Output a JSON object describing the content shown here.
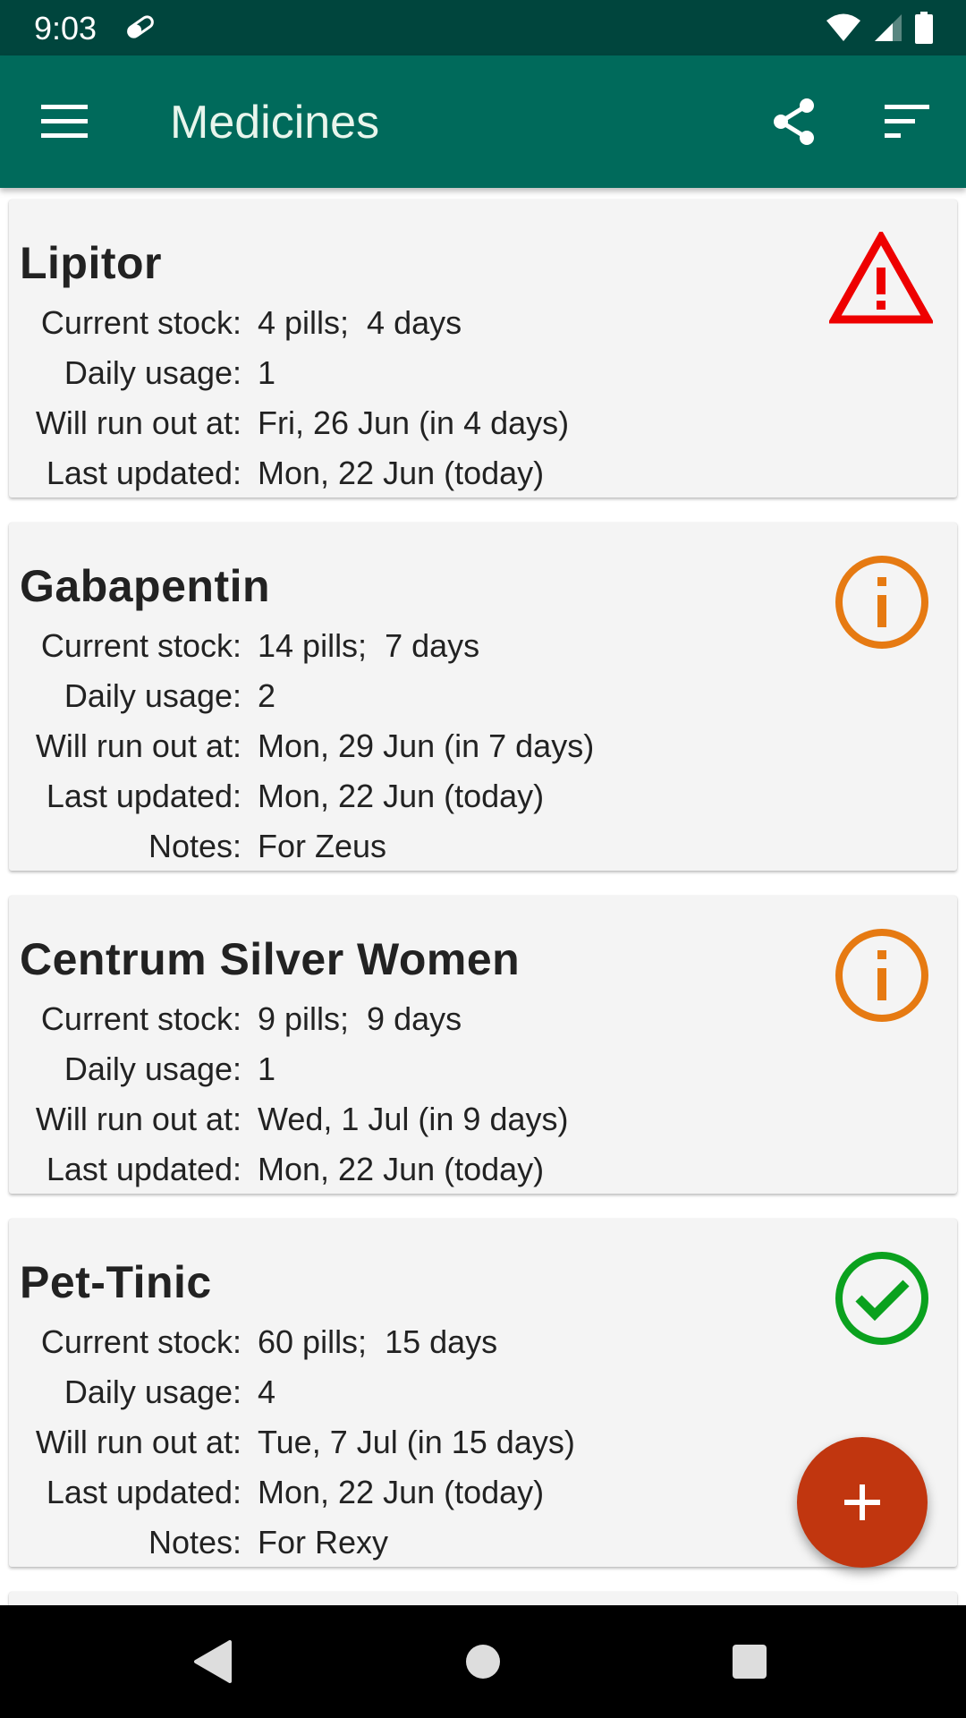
{
  "status_bar": {
    "time": "9:03",
    "icons": [
      "pill-notification-icon",
      "wifi-icon",
      "signal-icon",
      "battery-icon"
    ]
  },
  "app_bar": {
    "title": "Medicines",
    "icons": {
      "menu": "menu-icon",
      "share": "share-icon",
      "sort": "sort-icon"
    },
    "background_color": "#006a5b"
  },
  "labels": {
    "current_stock": "Current stock:",
    "daily_usage": "Daily usage:",
    "run_out": "Will run out at:",
    "last_updated": "Last updated:",
    "notes": "Notes:"
  },
  "medicines": [
    {
      "name": "Lipitor",
      "current_stock": "4 pills;  4 days",
      "daily_usage": "1",
      "run_out": "Fri, 26 Jun (in 4 days)",
      "last_updated": "Mon, 22 Jun (today)",
      "notes": "",
      "status": "warning",
      "status_icon": "warning-triangle-icon",
      "status_color": "#ee0000"
    },
    {
      "name": "Gabapentin",
      "current_stock": "14 pills;  7 days",
      "daily_usage": "2",
      "run_out": "Mon, 29 Jun (in 7 days)",
      "last_updated": "Mon, 22 Jun (today)",
      "notes": "For Zeus",
      "status": "info",
      "status_icon": "info-circle-icon",
      "status_color": "#e67a12"
    },
    {
      "name": "Centrum Silver Women",
      "current_stock": "9 pills;  9 days",
      "daily_usage": "1",
      "run_out": "Wed, 1 Jul (in 9 days)",
      "last_updated": "Mon, 22 Jun (today)",
      "notes": "",
      "status": "info",
      "status_icon": "info-circle-icon",
      "status_color": "#e67a12"
    },
    {
      "name": "Pet-Tinic",
      "current_stock": "60 pills;  15 days",
      "daily_usage": "4",
      "run_out": "Tue, 7 Jul (in 15 days)",
      "last_updated": "Mon, 22 Jun (today)",
      "notes": "For Rexy",
      "status": "ok",
      "status_icon": "check-circle-icon",
      "status_color": "#0aa11e"
    }
  ],
  "fab": {
    "icon": "plus-icon",
    "color": "#c1360f"
  },
  "nav_bar": {
    "icons": [
      "back-icon",
      "home-icon",
      "recents-icon"
    ]
  }
}
